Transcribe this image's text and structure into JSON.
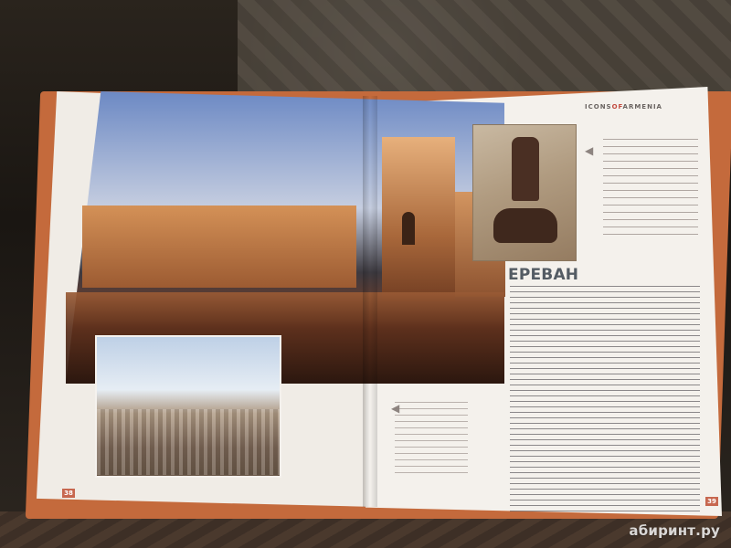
{
  "header": {
    "prefix": "ICONS",
    "connector": "OF",
    "suffix": "ARMENIA",
    "accent_color": "#c24a3f"
  },
  "article": {
    "title": "ЕРЕВАН"
  },
  "page_numbers": {
    "left": "38",
    "right": "39"
  },
  "watermark": {
    "text": "абиринт.ру"
  }
}
